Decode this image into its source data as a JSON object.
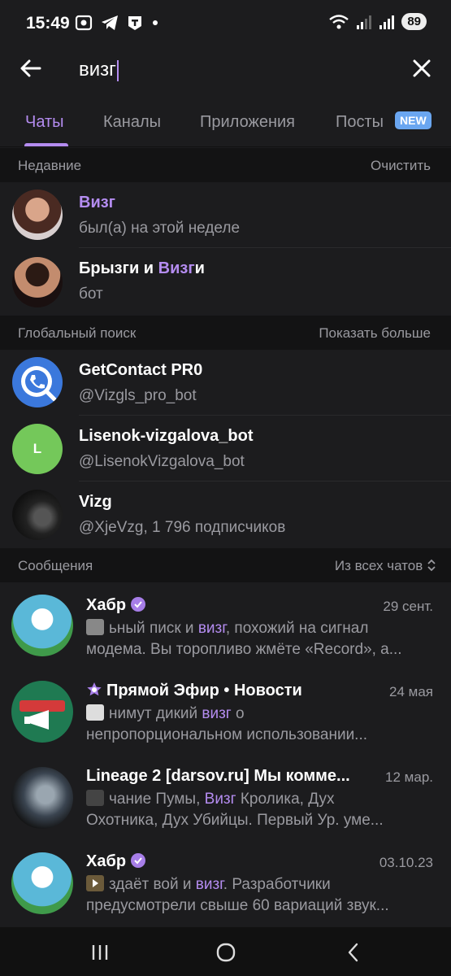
{
  "status_bar": {
    "time": "15:49",
    "battery": "89",
    "icons_left": [
      "screenshot-icon",
      "telegram-icon",
      "app-icon",
      "dot-icon"
    ],
    "icons_right": [
      "wifi-icon",
      "signal-icon",
      "signal-r-icon"
    ]
  },
  "search": {
    "query": "визг"
  },
  "tabs": [
    {
      "label": "Чаты",
      "active": true
    },
    {
      "label": "Каналы",
      "active": false
    },
    {
      "label": "Приложения",
      "active": false
    },
    {
      "label": "Посты",
      "active": false,
      "badge": "NEW"
    }
  ],
  "recent": {
    "title": "Недавние",
    "action": "Очистить",
    "items": [
      {
        "name_parts": [
          "",
          "Визг",
          ""
        ],
        "subtitle": "был(а) на этой неделе"
      },
      {
        "name_parts": [
          "Брызги и ",
          "Визг",
          "и"
        ],
        "subtitle": "бот"
      }
    ]
  },
  "global": {
    "title": "Глобальный поиск",
    "action": "Показать больше",
    "items": [
      {
        "name": "GetContact PR0",
        "subtitle": "@Vizgls_pro_bot",
        "avatar_color": "#3b78dc"
      },
      {
        "name": "Lisenok-vizgalova_bot",
        "subtitle": "@LisenokVizgalova_bot",
        "avatar_letter": "L",
        "avatar_color": "#74c85a"
      },
      {
        "name": "Vizg",
        "subtitle": "@XjeVzg, 1 796 подписчиков",
        "avatar_color": "#222222"
      }
    ]
  },
  "messages": {
    "title": "Сообщения",
    "filter": "Из всех чатов",
    "items": [
      {
        "title": "Хабр",
        "verified": true,
        "date": "29 сент.",
        "line1": [
          "ьный писк и ",
          "визг",
          ", похожий на сигнал"
        ],
        "line2": "модема. Вы торопливо жмёте «Record», а..."
      },
      {
        "title": "Прямой Эфир • Новости",
        "verified_prefix": true,
        "date": "24 мая",
        "line1": [
          "нимут дикий ",
          "визг",
          " о"
        ],
        "line2": "непропорциональном использовании..."
      },
      {
        "title": "Lineage 2 [darsov.ru] Мы комме...",
        "date": "12 мар.",
        "line1": [
          "чание Пумы, ",
          "Визг",
          " Кролика, Дух"
        ],
        "line2": "Охотника, Дух Убийцы.  Первый Ур. уме..."
      },
      {
        "title": "Хабр",
        "verified": true,
        "date": "03.10.23",
        "line1": [
          "здаёт вой и ",
          "визг",
          ". Разработчики"
        ],
        "line2": "предусмотрели свыше 60 вариаций звук..."
      }
    ]
  },
  "colors": {
    "accent": "#b48cf0",
    "background": "#1c1c1e",
    "section_bg": "#131314",
    "muted_text": "#9a9aa0",
    "new_badge": "#6aa6f0"
  }
}
